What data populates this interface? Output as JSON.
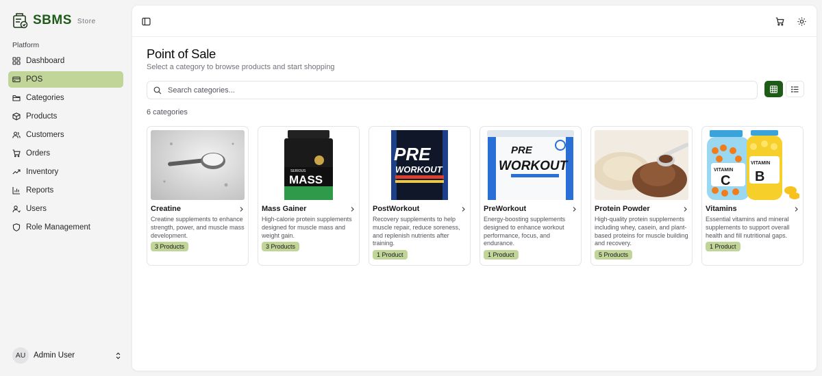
{
  "brand": {
    "name": "SBMS",
    "sub": "Store"
  },
  "sidebar": {
    "section": "Platform",
    "items": [
      {
        "label": "Dashboard",
        "icon": "dashboard-icon"
      },
      {
        "label": "POS",
        "icon": "pos-icon",
        "active": true
      },
      {
        "label": "Categories",
        "icon": "folder-icon"
      },
      {
        "label": "Products",
        "icon": "package-icon"
      },
      {
        "label": "Customers",
        "icon": "users-icon"
      },
      {
        "label": "Orders",
        "icon": "cart-icon"
      },
      {
        "label": "Inventory",
        "icon": "trend-icon"
      },
      {
        "label": "Reports",
        "icon": "chart-icon"
      },
      {
        "label": "Users",
        "icon": "user-icon"
      },
      {
        "label": "Role Management",
        "icon": "shield-icon"
      }
    ]
  },
  "user": {
    "initials": "AU",
    "name": "Admin User"
  },
  "page": {
    "title": "Point of Sale",
    "subtitle": "Select a category to browse products and start shopping",
    "search_placeholder": "Search categories...",
    "count": "6 categories"
  },
  "categories": [
    {
      "name": "Creatine",
      "desc": "Creatine supplements to enhance strength, power, and muscle mass development.",
      "badge": "3 Products"
    },
    {
      "name": "Mass Gainer",
      "desc": "High-calorie protein supplements designed for muscle mass and weight gain.",
      "badge": "3 Products"
    },
    {
      "name": "PostWorkout",
      "desc": "Recovery supplements to help muscle repair, reduce soreness, and replenish nutrients after training.",
      "badge": "1 Product"
    },
    {
      "name": "PreWorkout",
      "desc": "Energy-boosting supplements designed to enhance workout performance, focus, and endurance.",
      "badge": "1 Product"
    },
    {
      "name": "Protein Powder",
      "desc": "High-quality protein supplements including whey, casein, and plant-based proteins for muscle building and recovery.",
      "badge": "5 Products"
    },
    {
      "name": "Vitamins",
      "desc": "Essential vitamins and mineral supplements to support overall health and fill nutritional gaps.",
      "badge": "1 Product"
    }
  ],
  "images": {
    "mass_brand": "SERIOUS",
    "mass_word": "MASS",
    "pre_word": "PRE",
    "workout_word": "WORKOUT",
    "vit_c": "C",
    "vit_b": "B",
    "vitamin_word": "VITAMIN"
  },
  "colors": {
    "accent": "#1e5b16",
    "active_nav": "#c1d598",
    "brand": "#1f5b1a"
  }
}
